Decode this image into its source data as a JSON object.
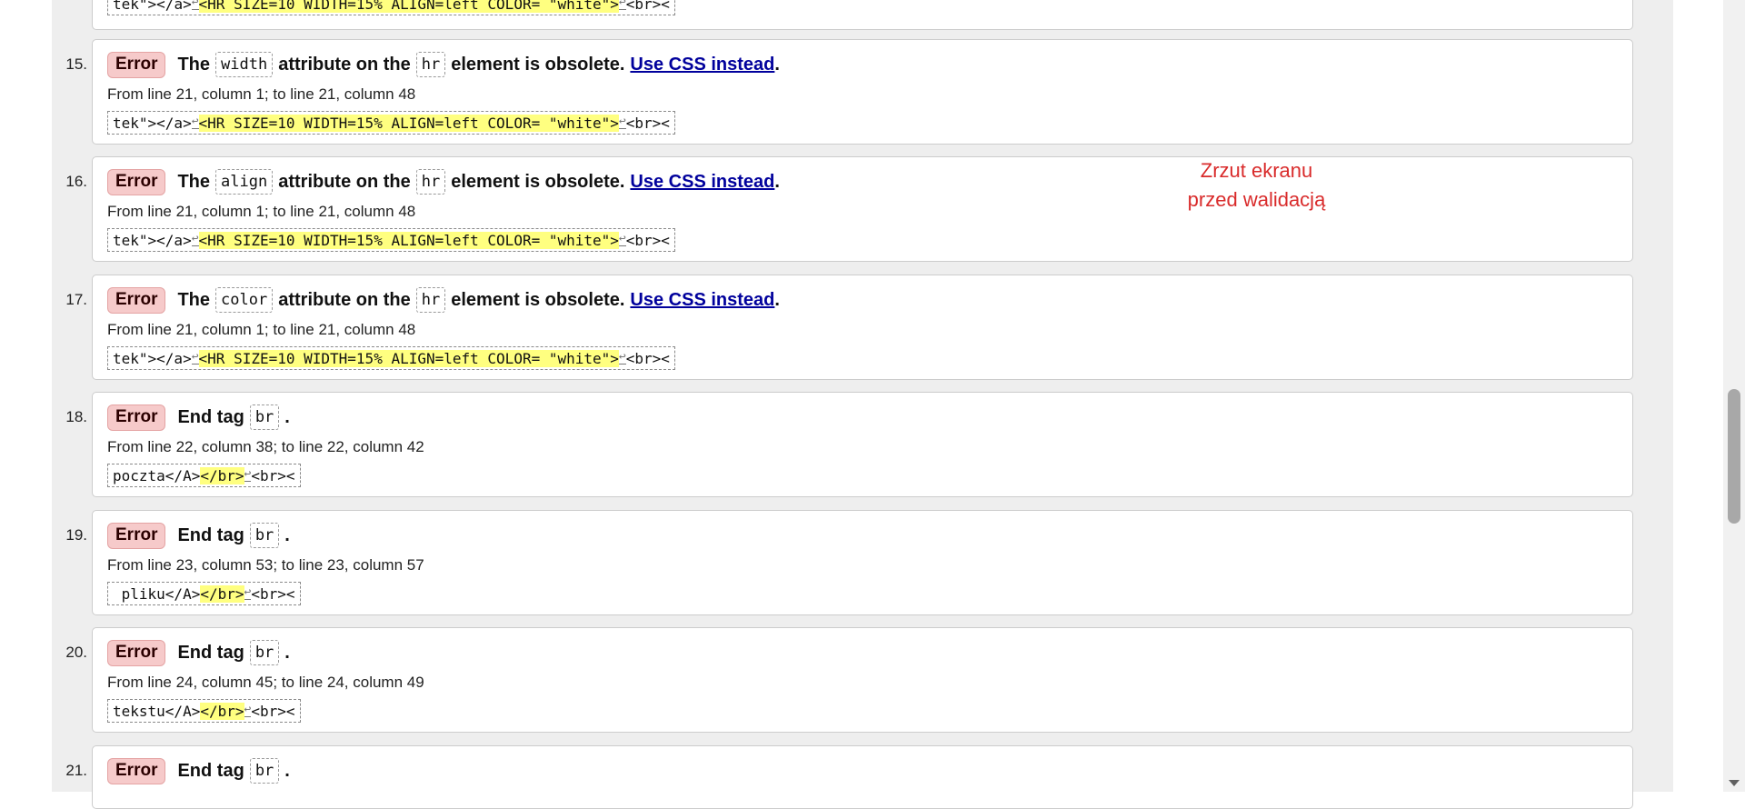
{
  "prev_extract": {
    "before": "tek\">",
    "pre2": "</a>",
    "hl": "<HR SIZE=10 WIDTH=15% ALIGN=left COLOR= \"white\">",
    "after": "<br><"
  },
  "entries": [
    {
      "num": "15.",
      "badge": "Error",
      "type": "obsolete",
      "text1": "The",
      "attr": "width",
      "text2": "attribute on the",
      "element": "hr",
      "text3": "element is obsolete.",
      "link": "Use CSS instead",
      "end": ".",
      "location": "From line 21, column 1; to line 21, column 48",
      "extract": {
        "before": "tek\"></a>",
        "hl": "<HR SIZE=10 WIDTH=15% ALIGN=left COLOR= \"white\">",
        "after": "<br><"
      }
    },
    {
      "num": "16.",
      "badge": "Error",
      "type": "obsolete",
      "text1": "The",
      "attr": "align",
      "text2": "attribute on the",
      "element": "hr",
      "text3": "element is obsolete.",
      "link": "Use CSS instead",
      "end": ".",
      "location": "From line 21, column 1; to line 21, column 48",
      "extract": {
        "before": "tek\"></a>",
        "hl": "<HR SIZE=10 WIDTH=15% ALIGN=left COLOR= \"white\">",
        "after": "<br><"
      }
    },
    {
      "num": "17.",
      "badge": "Error",
      "type": "obsolete",
      "text1": "The",
      "attr": "color",
      "text2": "attribute on the",
      "element": "hr",
      "text3": "element is obsolete.",
      "link": "Use CSS instead",
      "end": ".",
      "location": "From line 21, column 1; to line 21, column 48",
      "extract": {
        "before": "tek\"></a>",
        "hl": "<HR SIZE=10 WIDTH=15% ALIGN=left COLOR= \"white\">",
        "after": "<br><"
      }
    },
    {
      "num": "18.",
      "badge": "Error",
      "type": "endtag",
      "text1": "End tag",
      "element": "br",
      "end": ".",
      "location": "From line 22, column 38; to line 22, column 42",
      "extract": {
        "before": "poczta</A>",
        "hl": "</br>",
        "after": "<br><"
      }
    },
    {
      "num": "19.",
      "badge": "Error",
      "type": "endtag",
      "text1": "End tag",
      "element": "br",
      "end": ".",
      "location": "From line 23, column 53; to line 23, column 57",
      "extract": {
        "before": " pliku</A>",
        "hl": "</br>",
        "after": "<br><"
      }
    },
    {
      "num": "20.",
      "badge": "Error",
      "type": "endtag",
      "text1": "End tag",
      "element": "br",
      "end": ".",
      "location": "From line 24, column 45; to line 24, column 49",
      "extract": {
        "before": "tekstu</A>",
        "hl": "</br>",
        "after": "<br><"
      }
    },
    {
      "num": "21.",
      "badge": "Error",
      "type": "endtag",
      "text1": "End tag",
      "element": "br",
      "end": "."
    }
  ],
  "annotation": {
    "line1": "Zrzut ekranu",
    "line2": "przed walidacją"
  }
}
